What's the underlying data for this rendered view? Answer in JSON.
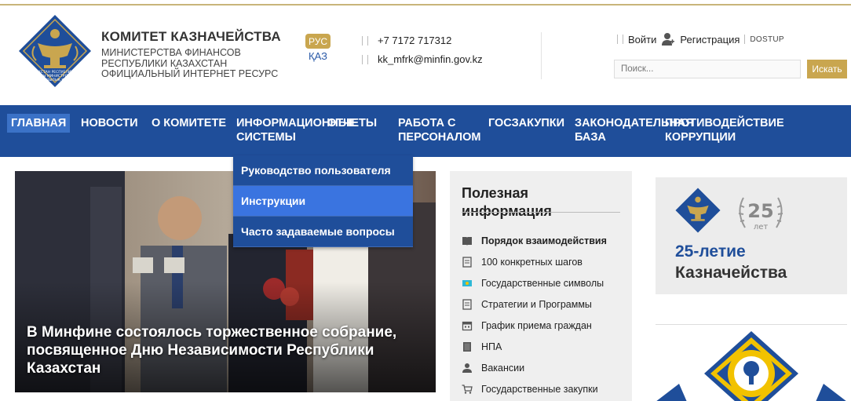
{
  "header": {
    "org_title": "КОМИТЕТ КАЗНАЧЕЙСТВА",
    "org_sub_1": "МИНИСТЕРСТВА ФИНАНСОВ",
    "org_sub_2": "РЕСПУБЛИКИ КАЗАХСТАН",
    "org_sub_3": "ОФИЦИАЛЬНЫЙ ИНТЕРНЕТ РЕСУРС",
    "logo_text_1": "ҚАЗАҚСТАН РЕСПУБЛИКАСЫ",
    "logo_text_2": "ҚАРЖЫ МИНИСТРЛІГІНІҢ",
    "logo_text_3": "ҚАЗЫНАШЫЛЫҚ КОМИТЕТІ",
    "lang_ru": "РУС",
    "lang_kz": "ҚАЗ",
    "phone": "+7 7172 717312",
    "email": "kk_mfrk@minfin.gov.kz",
    "login": "Войти",
    "register": "Регистрация",
    "dostup": "DOSTUP",
    "search_placeholder": "Поиск...",
    "search_button": "Искать"
  },
  "nav": {
    "items": [
      {
        "label": "ГЛАВНАЯ"
      },
      {
        "label": "НОВОСТИ"
      },
      {
        "label": "О КОМИТЕТЕ"
      },
      {
        "label_1": "ИНФОРМАЦИОННЫЕ",
        "label_2": "СИСТЕМЫ"
      },
      {
        "label": "ОТЧЕТЫ"
      },
      {
        "label_1": "РАБОТА С",
        "label_2": "ПЕРСОНАЛОМ"
      },
      {
        "label": "ГОСЗАКУПКИ"
      },
      {
        "label_1": "ЗАКОНОДАТЕЛЬНАЯ",
        "label_2": "БАЗА"
      },
      {
        "label_1": "ПРОТИВОДЕЙСТВИЕ",
        "label_2": "КОРРУПЦИИ"
      }
    ]
  },
  "dropdown": {
    "items": [
      {
        "label": "Руководство пользователя"
      },
      {
        "label": "Инструкции"
      },
      {
        "label": "Часто задаваемые вопросы"
      }
    ]
  },
  "hero": {
    "caption": "В Минфине состоялось торжественное собрание, посвященное Дню Независимости Республики Казахстан"
  },
  "info": {
    "title_1": "Полезная",
    "title_2": "информация",
    "items": [
      {
        "label": "Порядок взаимодействия",
        "icon": "book-icon"
      },
      {
        "label": "100 конкретных шагов",
        "icon": "document-icon"
      },
      {
        "label": "Государственные символы",
        "icon": "flag-icon"
      },
      {
        "label": "Стратегии и Программы",
        "icon": "document-icon"
      },
      {
        "label": "График приема граждан",
        "icon": "calendar-icon"
      },
      {
        "label": "НПА",
        "icon": "book-icon"
      },
      {
        "label": "Вакансии",
        "icon": "person-icon"
      },
      {
        "label": "Государственные закупки",
        "icon": "cart-icon"
      }
    ]
  },
  "banner": {
    "years": "25",
    "years_word": "лет",
    "title_1": "25-летие",
    "title_2": "Казначейства"
  },
  "colors": {
    "nav": "#1f4e9a",
    "accent": "#c9a64f",
    "hover": "#3a74e0"
  }
}
